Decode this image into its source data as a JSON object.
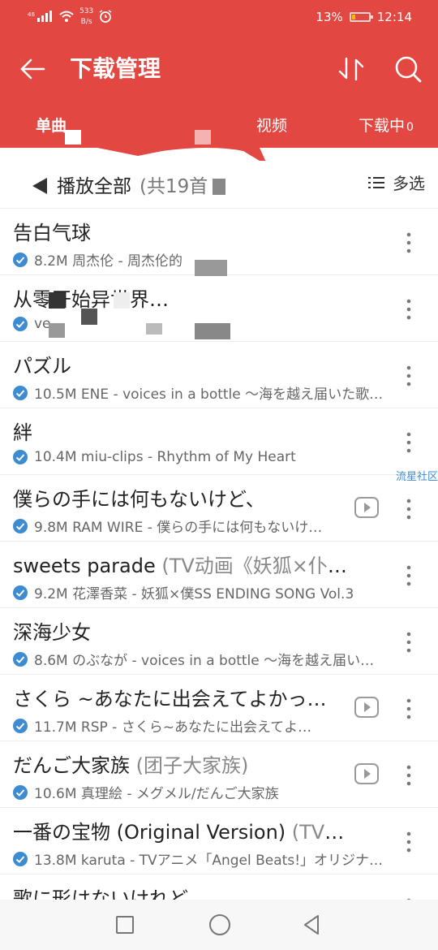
{
  "status": {
    "signal": "46",
    "net_speed": "533",
    "net_unit": "B/s",
    "battery": "13%",
    "time": "12:14"
  },
  "header": {
    "title": "下载管理"
  },
  "tabs": {
    "first": "单曲",
    "video": "视频",
    "downloading": "下载中",
    "downloading_count": "0"
  },
  "toolbar": {
    "play_all": "播放全部",
    "count": "(共19首",
    "multi_select": "多选"
  },
  "songs": [
    {
      "title": "告白气球",
      "title_extra": "",
      "meta": "8.2M 周杰伦 - 周杰伦的",
      "has_mv": false
    },
    {
      "title": "从零开始异世界…",
      "title_extra": "",
      "meta": "ve",
      "has_mv": false
    },
    {
      "title": "パズル",
      "title_extra": "",
      "meta": "10.5M ENE - voices in a bottle ～海を越え届いた歌…",
      "has_mv": false
    },
    {
      "title": "絆",
      "title_extra": "",
      "meta": "10.4M miu-clips - Rhythm of My Heart",
      "has_mv": false
    },
    {
      "title": "僕らの手には何もないけど、",
      "title_extra": "",
      "meta": "9.8M RAM WIRE - 僕らの手には何もないけ…",
      "has_mv": true
    },
    {
      "title": "sweets parade ",
      "title_extra": "(TV动画《妖狐×仆SS》…",
      "meta": "9.2M 花澤香菜 - 妖狐×僕SS ENDING SONG Vol.3",
      "has_mv": false
    },
    {
      "title": "深海少女",
      "title_extra": "",
      "meta": "8.6M のぶなが - voices in a bottle ～海を越え届い…",
      "has_mv": false
    },
    {
      "title": "さくら ~あなたに出会えてよかっ…",
      "title_extra": "",
      "meta": "11.7M RSP - さくら~あなたに出会えてよ…",
      "has_mv": true
    },
    {
      "title": "だんご大家族 ",
      "title_extra": "(团子大家族)",
      "meta": "10.6M 真理絵 - メグメル/だんご大家族",
      "has_mv": true
    },
    {
      "title": "一番の宝物 (Original Version) ",
      "title_extra": "(TV动画…",
      "meta": "13.8M karuta - TVアニメ「Angel Beats!」オリジナ…",
      "has_mv": false
    },
    {
      "title": "歌に形はないけれど",
      "title_extra": "",
      "meta": "",
      "has_mv": false
    }
  ],
  "watermark": "流星社区",
  "colors": {
    "accent": "#e34741",
    "check": "#3d8cd2"
  }
}
